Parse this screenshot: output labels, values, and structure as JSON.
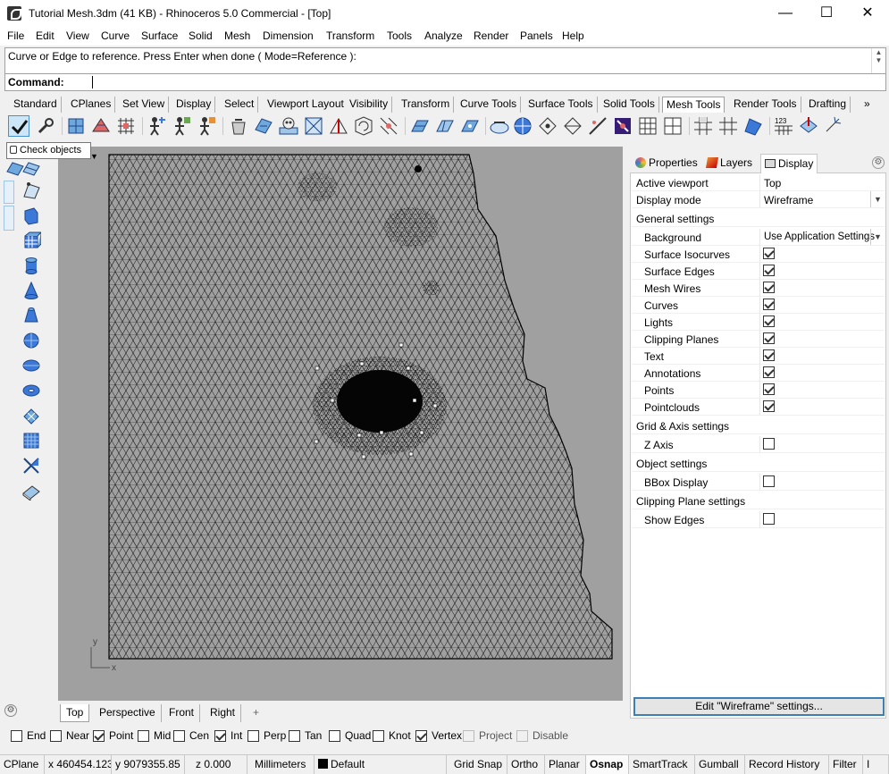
{
  "window": {
    "title": "Tutorial Mesh.3dm (41 KB) - Rhinoceros 5.0 Commercial - [Top]",
    "minimize": "—",
    "maximize": "☐",
    "close": "✕"
  },
  "menu": [
    "File",
    "Edit",
    "View",
    "Curve",
    "Surface",
    "Solid",
    "Mesh",
    "Dimension",
    "Transform",
    "Tools",
    "Analyze",
    "Render",
    "Panels",
    "Help"
  ],
  "command": {
    "history": "Curve or Edge to reference. Press Enter when done ( Mode=Reference ):",
    "prompt": "Command:"
  },
  "toolbar_tabs": [
    "Standard",
    "CPlanes",
    "Set View",
    "Display",
    "Select",
    "Viewport Layout",
    "Visibility",
    "Transform",
    "Curve Tools",
    "Surface Tools",
    "Solid Tools",
    "Mesh Tools",
    "Render Tools",
    "Drafting"
  ],
  "toolbar_tabs_active": "Mesh Tools",
  "toolbar_more": "»",
  "tooltip": "Check objects",
  "viewport": {
    "axis_x": "x",
    "axis_y": "y",
    "tabs": [
      "Top",
      "Perspective",
      "Front",
      "Right"
    ],
    "active_tab": "Top",
    "add_tab": "+"
  },
  "panel": {
    "tabs": [
      "Properties",
      "Layers",
      "Display"
    ],
    "active_tab": "Display",
    "active_viewport_label": "Active viewport",
    "active_viewport_value": "Top",
    "display_mode_label": "Display mode",
    "display_mode_value": "Wireframe",
    "general_settings": "General settings",
    "background_label": "Background",
    "background_value": "Use Application Settings",
    "general_items": [
      {
        "label": "Surface Isocurves",
        "checked": true
      },
      {
        "label": "Surface Edges",
        "checked": true
      },
      {
        "label": "Mesh Wires",
        "checked": true
      },
      {
        "label": "Curves",
        "checked": true
      },
      {
        "label": "Lights",
        "checked": true
      },
      {
        "label": "Clipping Planes",
        "checked": true
      },
      {
        "label": "Text",
        "checked": true
      },
      {
        "label": "Annotations",
        "checked": true
      },
      {
        "label": "Points",
        "checked": true
      },
      {
        "label": "Pointclouds",
        "checked": true
      }
    ],
    "grid_axis_settings": "Grid & Axis settings",
    "z_axis_label": "Z Axis",
    "z_axis_checked": false,
    "object_settings": "Object settings",
    "bbox_label": "BBox Display",
    "bbox_checked": false,
    "clipping_plane_settings": "Clipping Plane settings",
    "show_edges_label": "Show Edges",
    "show_edges_checked": false,
    "edit_button": "Edit \"Wireframe\" settings..."
  },
  "osnap": [
    {
      "label": "End",
      "checked": false,
      "disabled": false
    },
    {
      "label": "Near",
      "checked": false,
      "disabled": false
    },
    {
      "label": "Point",
      "checked": true,
      "disabled": false
    },
    {
      "label": "Mid",
      "checked": false,
      "disabled": false
    },
    {
      "label": "Cen",
      "checked": false,
      "disabled": false
    },
    {
      "label": "Int",
      "checked": true,
      "disabled": false
    },
    {
      "label": "Perp",
      "checked": false,
      "disabled": false
    },
    {
      "label": "Tan",
      "checked": false,
      "disabled": false
    },
    {
      "label": "Quad",
      "checked": false,
      "disabled": false
    },
    {
      "label": "Knot",
      "checked": false,
      "disabled": false
    },
    {
      "label": "Vertex",
      "checked": true,
      "disabled": false
    },
    {
      "label": "Project",
      "checked": false,
      "disabled": true
    },
    {
      "label": "Disable",
      "checked": false,
      "disabled": true
    }
  ],
  "status": {
    "cplane": "CPlane",
    "x": "x 460454.123",
    "y": "y 9079355.85",
    "z": "z 0.000",
    "units": "Millimeters",
    "layer": "Default",
    "grid_snap": "Grid Snap",
    "ortho": "Ortho",
    "planar": "Planar",
    "osnap": "Osnap",
    "smarttrack": "SmartTrack",
    "gumball": "Gumball",
    "record_history": "Record History",
    "filter": "Filter",
    "more": "I"
  }
}
